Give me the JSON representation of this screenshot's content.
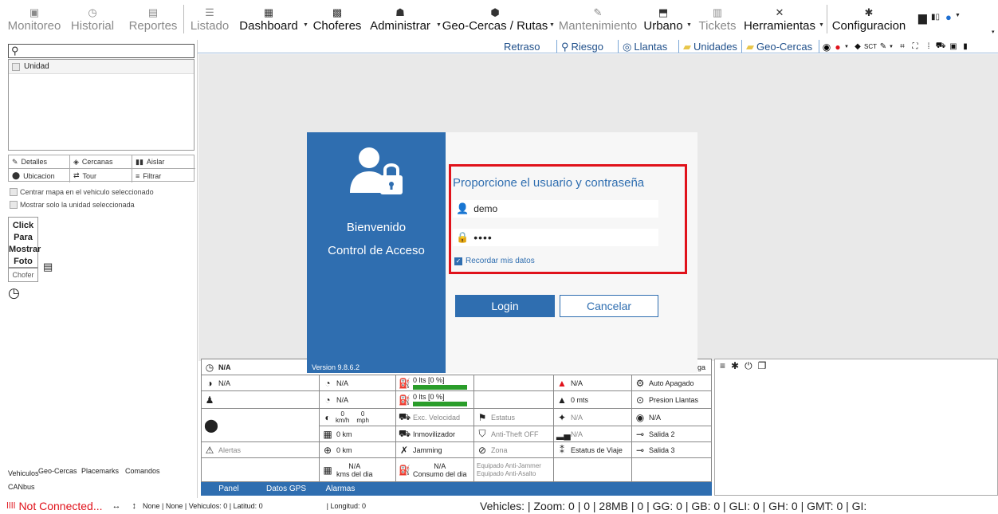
{
  "menu": [
    {
      "label": "Monitoreo",
      "icon": "monitor-icon",
      "glyph": "▣",
      "dim": true
    },
    {
      "label": "Historial",
      "icon": "history-icon",
      "glyph": "◷",
      "dim": true
    },
    {
      "label": "Reportes",
      "icon": "report-icon",
      "glyph": "▤",
      "dim": true
    },
    {
      "label": "Listado",
      "icon": "list-icon",
      "glyph": "☰",
      "dim": true
    },
    {
      "label": "Dashboard",
      "icon": "dashboard-icon",
      "glyph": "▦",
      "dim": false
    },
    {
      "label": "Choferes",
      "icon": "drivers-icon",
      "glyph": "▩",
      "dim": false
    },
    {
      "label": "Administrar",
      "icon": "admin-icon",
      "glyph": "☗",
      "dim": false
    },
    {
      "label": "Geo-Cercas / Rutas",
      "icon": "geofence-icon",
      "glyph": "⬢",
      "dim": false
    },
    {
      "label": "Mantenimiento",
      "icon": "wrench-icon",
      "glyph": "✎",
      "dim": true
    },
    {
      "label": "Urbano",
      "icon": "bus-icon",
      "glyph": "⬒",
      "dim": false
    },
    {
      "label": "Tickets",
      "icon": "ticket-icon",
      "glyph": "▥",
      "dim": true
    },
    {
      "label": "Herramientas",
      "icon": "tools-icon",
      "glyph": "✕",
      "dim": false
    },
    {
      "label": "Configuracion",
      "icon": "gear-icon",
      "glyph": "✱",
      "dim": false
    }
  ],
  "strip": {
    "retraso": "Retraso",
    "riesgo": "Riesgo",
    "llantas": "Llantas",
    "unidades": "Unidades",
    "geocercas": "Geo-Cercas",
    "sct": "SCT"
  },
  "left": {
    "search_placeholder": "",
    "unit_header": "Unidad",
    "buttons": {
      "detalles": "Detalles",
      "cercanas": "Cercanas",
      "aislar": "Aislar",
      "ubicacion": "Ubicacion",
      "tour": "Tour",
      "filtrar": "Filtrar"
    },
    "check_center": "Centrar mapa en el vehiculo seleccionado",
    "check_only": "Mostrar solo la unidad seleccionada",
    "photo": "Click Para Mostrar Foto",
    "chofer": "Chofer",
    "tabs": {
      "vehiculos": "Vehiculos",
      "geocercas": "Geo-Cercas",
      "placemarks": "Placemarks",
      "comandos": "Comandos",
      "canbus": "CANbus"
    }
  },
  "login": {
    "welcome": "Bienvenido",
    "subtitle": "Control de Acceso",
    "version": "Version 9.8.6.2",
    "prompt": "Proporcione el usuario y contraseña",
    "username": "demo",
    "password": "••••",
    "remember": "Recordar mis datos",
    "login_btn": "Login",
    "cancel_btn": "Cancelar"
  },
  "grid": {
    "r1c1": "N/A",
    "r1c1b": "ga",
    "r2c1": "N/A",
    "r2c2": "N/A",
    "r2c3": "0 lts [0 %]",
    "r2c5": "N/A",
    "r2c6": "Auto Apagado",
    "r3c2": "N/A",
    "r3c3": "0 lts [0 %]",
    "r3c5": "0 mts",
    "r3c6": "Presion Llantas",
    "kmh_val": "0",
    "kmh_unit": "km/h",
    "mph_val": "0",
    "mph_unit": "mph",
    "r4c3": "Exc. Velocidad",
    "r4c4": "Estatus",
    "r4c5": "N/A",
    "r4c6": "N/A",
    "r5c2": "0 km",
    "r5c3": "Inmovilizador",
    "r5c4": "Anti-Theft OFF",
    "r5c5": "N/A",
    "r5c6": "Salida 2",
    "r6c1": "Alertas",
    "r6c2": "0 km",
    "r6c3": "Jamming",
    "r6c4": "Zona",
    "r6c5": "Estatus de Viaje",
    "r6c6": "Salida 3",
    "r7c2a": "N/A",
    "r7c2b": "kms del dia",
    "r7c3a": "N/A",
    "r7c3b": "Consumo del dia",
    "r7c4a": "Equipado Anti-Jammer",
    "r7c4b": "Equipado Anti-Asalto"
  },
  "bottom_tabs": {
    "panel": "Panel",
    "datos": "Datos GPS",
    "alarmas": "Alarmas"
  },
  "status": {
    "connection": "Not Connected...",
    "info": "None | None | Vehiculos: 0 | Latitud: 0",
    "longitud": "| Longitud: 0",
    "right": "Vehicles: | Zoom: 0 | 0 | 28MB | 0 | GG: 0 | GB: 0 | GLI: 0 | GH: 0 | GMT: 0 | GI:"
  },
  "colors": {
    "accent": "#2f6eb0",
    "alert": "#e0121b",
    "fuel": "#2a9d2a"
  }
}
